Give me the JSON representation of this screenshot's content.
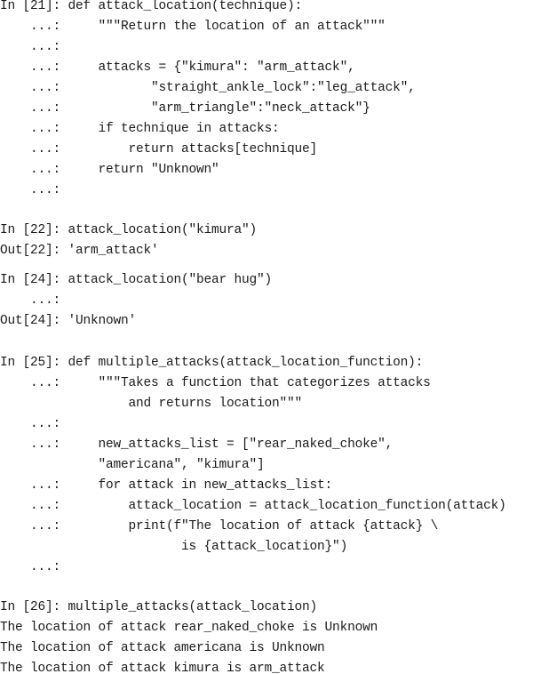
{
  "lines": [
    "In [21]: def attack_location(technique):",
    "    ...:     \"\"\"Return the location of an attack\"\"\"",
    "    ...:",
    "    ...:     attacks = {\"kimura\": \"arm_attack\",",
    "    ...:            \"straight_ankle_lock\":\"leg_attack\",",
    "    ...:            \"arm_triangle\":\"neck_attack\"}",
    "    ...:     if technique in attacks:",
    "    ...:         return attacks[technique]",
    "    ...:     return \"Unknown\"",
    "    ...:",
    "In [22]: attack_location(\"kimura\")",
    "Out[22]: 'arm_attack'",
    "In [24]: attack_location(\"bear hug\")",
    "    ...:",
    "Out[24]: 'Unknown'",
    "In [25]: def multiple_attacks(attack_location_function):",
    "    ...:     \"\"\"Takes a function that categorizes attacks",
    "                 and returns location\"\"\"",
    "    ...:",
    "    ...:     new_attacks_list = [\"rear_naked_choke\",",
    "             \"americana\", \"kimura\"]",
    "    ...:     for attack in new_attacks_list:",
    "    ...:         attack_location = attack_location_function(attack)",
    "    ...:         print(f\"The location of attack {attack} \\",
    "                        is {attack_location}\")",
    "    ...:",
    "In [26]: multiple_attacks(attack_location)",
    "The location of attack rear_naked_choke is Unknown",
    "The location of attack americana is Unknown",
    "The location of attack kimura is arm_attack"
  ]
}
